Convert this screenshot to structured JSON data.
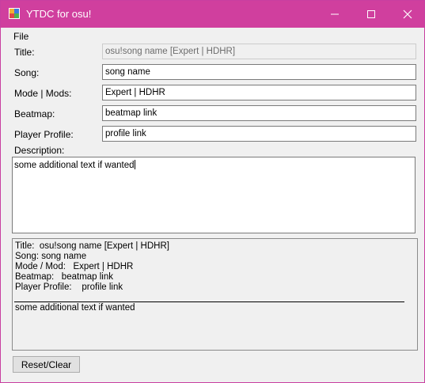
{
  "window": {
    "title": "YTDC for osu!",
    "accent_color": "#d03f9e"
  },
  "menu": {
    "file": "File"
  },
  "form": {
    "title_label": "Title:",
    "title_value": "osu!song name [Expert | HDHR]",
    "song_label": "Song:",
    "song_value": "song name",
    "mode_label": "Mode | Mods:",
    "mode_value": "Expert | HDHR",
    "beatmap_label": "Beatmap:",
    "beatmap_value": "beatmap link",
    "profile_label": "Player Profile:",
    "profile_value": "profile link",
    "description_label": "Description:",
    "description_value": "some additional text if wanted"
  },
  "preview": {
    "lines": [
      "Title:  osu!song name [Expert | HDHR]",
      "Song: song name",
      "Mode / Mod:   Expert | HDHR",
      "Beatmap:   beatmap link",
      "Player Profile:    profile link"
    ],
    "description": "some additional text if wanted"
  },
  "buttons": {
    "reset": "Reset/Clear"
  },
  "icons": {
    "app": "app-icon",
    "minimize": "minimize-icon",
    "maximize": "maximize-icon",
    "close": "close-icon"
  }
}
